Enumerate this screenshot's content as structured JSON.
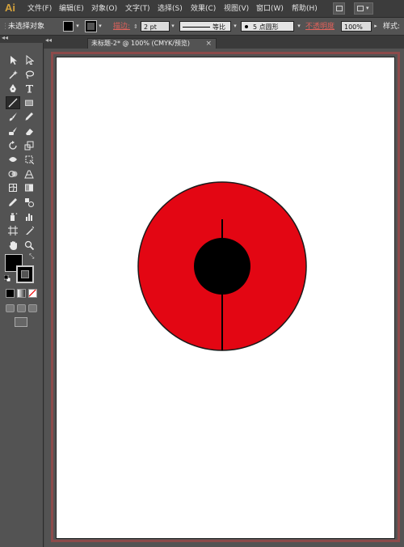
{
  "app": {
    "logo": "Ai",
    "menus": [
      "文件(F)",
      "编辑(E)",
      "对象(O)",
      "文字(T)",
      "选择(S)",
      "效果(C)",
      "视图(V)",
      "窗口(W)",
      "帮助(H)"
    ]
  },
  "control_bar": {
    "selection_status": "未选择对象",
    "stroke_label": "描边:",
    "stroke_weight": "2 pt",
    "profile_label": "等比",
    "brush_label": "5 点圆形",
    "opacity_label": "不透明度",
    "opacity_value": "100%",
    "style_label": "样式:"
  },
  "document": {
    "tab_title": "未标题-2* @ 100% (CMYK/预览)",
    "close_glyph": "×"
  },
  "colors": {
    "accent_red": "#e30613",
    "inner_circle": "#000000",
    "artboard": "#ffffff",
    "fill_swatch": "#000000",
    "stroke_swatch": "#000000"
  },
  "artwork": {
    "description_items": [
      "red-outer-circle",
      "black-inner-circle",
      "vertical-line"
    ]
  },
  "toolbar": {
    "tools": [
      "selection-tool",
      "direct-selection-tool",
      "magic-wand-tool",
      "lasso-tool",
      "pen-tool",
      "type-tool",
      "line-segment-tool",
      "rectangle-tool",
      "paintbrush-tool",
      "pencil-tool",
      "blob-brush-tool",
      "eraser-tool",
      "rotate-tool",
      "scale-tool",
      "width-tool",
      "free-transform-tool",
      "shape-builder-tool",
      "perspective-grid-tool",
      "mesh-tool",
      "gradient-tool",
      "eyedropper-tool",
      "blend-tool",
      "symbol-sprayer-tool",
      "column-graph-tool",
      "artboard-tool",
      "slice-tool",
      "hand-tool",
      "zoom-tool"
    ],
    "active_tool": "line-segment-tool"
  }
}
